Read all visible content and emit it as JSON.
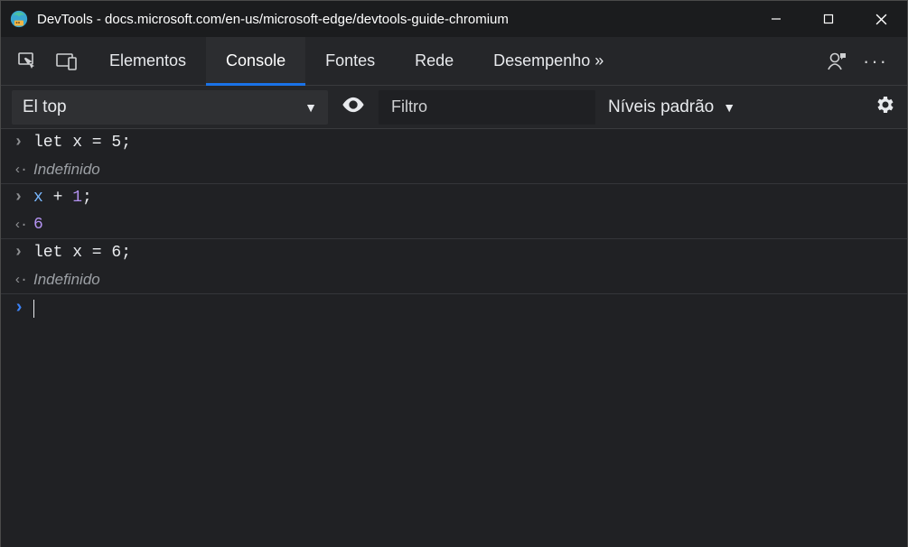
{
  "window": {
    "title": "DevTools - docs.microsoft.com/en-us/microsoft-edge/devtools-guide-chromium"
  },
  "tabs": {
    "elements": "Elementos",
    "console": "Console",
    "sources": "Fontes",
    "network": "Rede",
    "performance": "Desempenho »"
  },
  "filterbar": {
    "context_label": "El top",
    "filter_placeholder": "Filtro",
    "levels_label": "Níveis padrão"
  },
  "console_entries": [
    {
      "input": {
        "plain": "let x = 5;"
      },
      "output_type": "undef",
      "output": "Indefinido"
    },
    {
      "input": {
        "tokens": [
          [
            "var",
            "x"
          ],
          [
            "plain",
            " + "
          ],
          [
            "num",
            "1"
          ],
          [
            "plain",
            ";"
          ]
        ]
      },
      "output_type": "num",
      "output": "6"
    },
    {
      "input": {
        "plain": "let x = 6;"
      },
      "output_type": "undef",
      "output": "Indefinido"
    }
  ],
  "icons": {
    "inspect": "inspect-icon",
    "device": "device-toolbar-icon",
    "feedback": "feedback-icon",
    "more": "more-icon",
    "eye": "eye-icon",
    "gear": "gear-icon",
    "caret_down": "▼"
  }
}
